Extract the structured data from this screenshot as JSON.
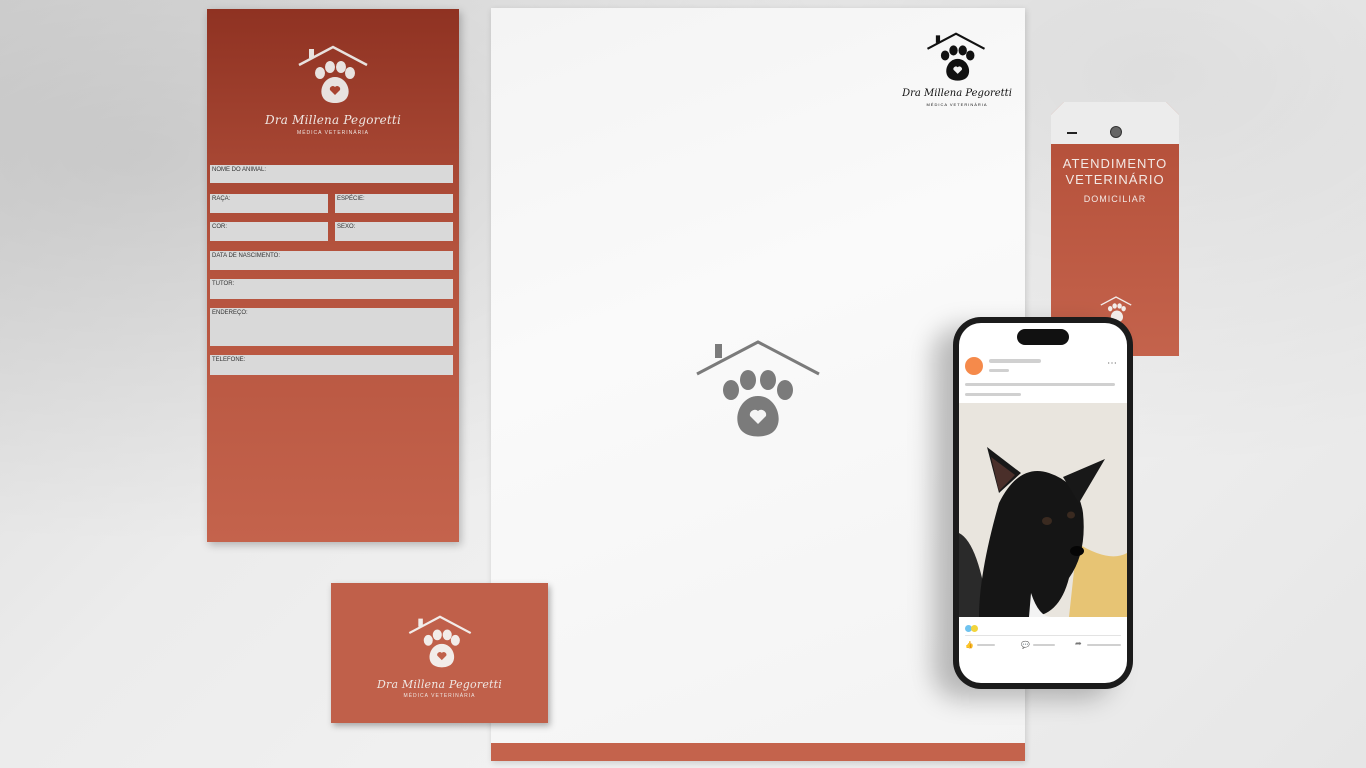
{
  "brand": {
    "name": "Dra Millena Pegoretti",
    "subtitle": "MÉDICA VETERINÁRIA",
    "colors": {
      "terracotta": "#c4634c",
      "dark_terracotta": "#8f3222",
      "paper": "#f4f4f4"
    }
  },
  "form_card": {
    "fields": {
      "animal_name": "NOME DO ANIMAL:",
      "breed": "RAÇA:",
      "species": "ESPÉCIE:",
      "color": "COR:",
      "sex": "SEXO:",
      "birth_date": "DATA DE NASCIMENTO:",
      "tutor": "TUTOR:",
      "address": "ENDEREÇO:",
      "phone": "TELEFONE:"
    }
  },
  "tag": {
    "line1": "ATENDIMENTO",
    "line2": "VETERINÁRIO",
    "line3": "DOMICILIAR"
  },
  "phone_post": {
    "reactions": [
      "like-icon",
      "comment-icon",
      "share-icon"
    ]
  }
}
